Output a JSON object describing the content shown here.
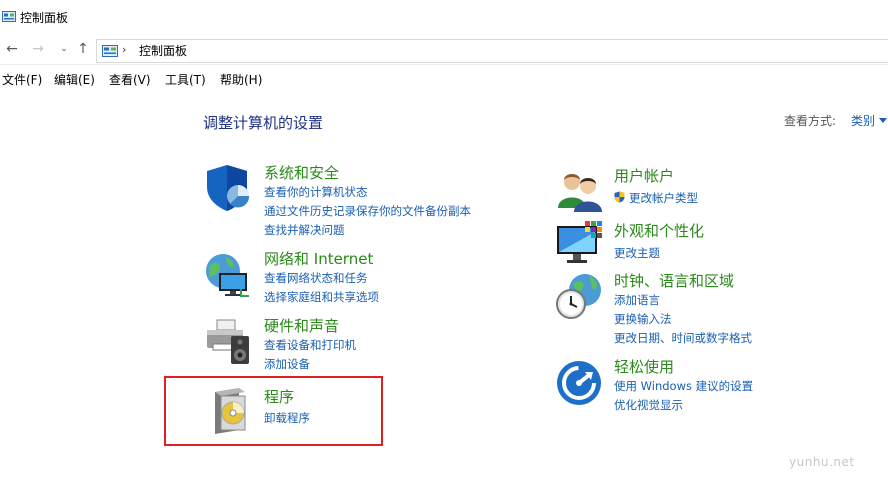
{
  "window": {
    "title": "控制面板"
  },
  "address": {
    "path": "控制面板"
  },
  "menu": [
    "文件(F)",
    "编辑(E)",
    "查看(V)",
    "工具(T)",
    "帮助(H)"
  ],
  "page": {
    "heading": "调整计算机的设置",
    "view_by_label": "查看方式:",
    "view_by_value": "类别"
  },
  "categories": {
    "system": {
      "title": "系统和安全",
      "links": [
        "查看你的计算机状态",
        "通过文件历史记录保存你的文件备份副本",
        "查找并解决问题"
      ]
    },
    "network": {
      "title": "网络和 Internet",
      "links": [
        "查看网络状态和任务",
        "选择家庭组和共享选项"
      ]
    },
    "hardware": {
      "title": "硬件和声音",
      "links": [
        "查看设备和打印机",
        "添加设备"
      ]
    },
    "programs": {
      "title": "程序",
      "links": [
        "卸载程序"
      ]
    },
    "users": {
      "title": "用户帐户",
      "links": [
        "更改帐户类型"
      ]
    },
    "appearance": {
      "title": "外观和个性化",
      "links": [
        "更改主题"
      ]
    },
    "clock": {
      "title": "时钟、语言和区域",
      "links": [
        "添加语言",
        "更换输入法",
        "更改日期、时间或数字格式"
      ]
    },
    "ease": {
      "title": "轻松使用",
      "links": [
        "使用 Windows 建议的设置",
        "优化视觉显示"
      ]
    }
  },
  "watermark": "yunhu.net",
  "colors": {
    "link": "#1a5fb4",
    "category_title": "#2a8a1a",
    "heading": "#1e3287",
    "highlight": "#e02020"
  }
}
